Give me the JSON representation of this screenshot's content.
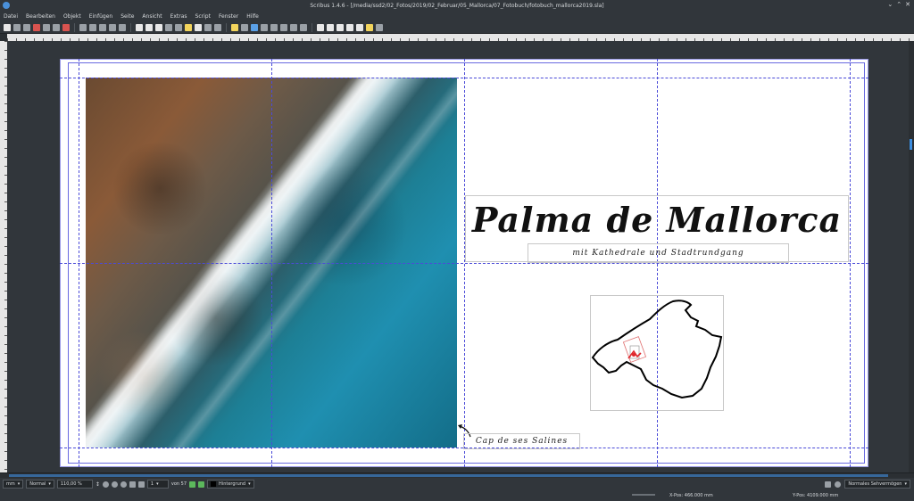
{
  "window": {
    "title": "Scribus 1.4.6 - [/media/ssd2/02_Fotos/2019/02_Februar/05_Mallorca/07_Fotobuch/fotobuch_mallorca2019.sla]"
  },
  "menu": [
    "Datei",
    "Bearbeiten",
    "Objekt",
    "Einfügen",
    "Seite",
    "Ansicht",
    "Extras",
    "Script",
    "Fenster",
    "Hilfe"
  ],
  "page": {
    "title": "Palma de Mallorca",
    "subtitle": "mit Kathedrale und Stadtrundgang",
    "caption": "Cap de ses Salines"
  },
  "status": {
    "unit": "mm",
    "mode": "Normal",
    "zoom": "110,00 %",
    "page_number": "1",
    "page_of": "von 57",
    "layer": "Hintergrund",
    "visibility": "Normales Sehvermögen",
    "xpos_label": "X-Pos:",
    "xpos_value": "466.000 mm",
    "ypos_label": "Y-Pos:",
    "ypos_value": "4109.000 mm"
  },
  "colors": {
    "guide": "#4b4bd8",
    "accent": "#3d8ee0",
    "map_marker": "#e0262b"
  }
}
